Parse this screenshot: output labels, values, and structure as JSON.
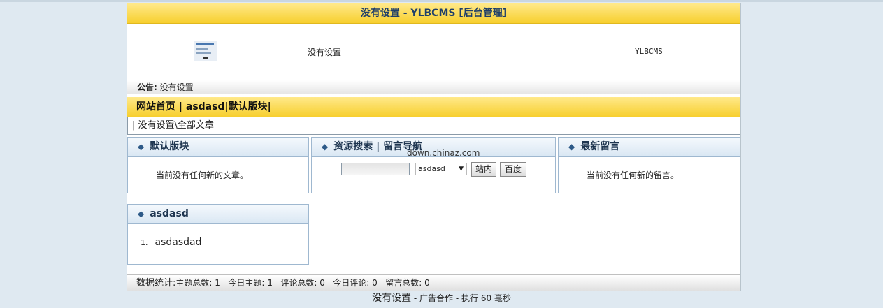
{
  "header": {
    "title_prefix": "没有设置",
    "title_cms": "- YLBCMS [后台管理]"
  },
  "site": {
    "name": "没有设置",
    "right_text": "YLBCMS"
  },
  "notice": {
    "label": "公告:",
    "text": "没有设置"
  },
  "nav": {
    "items": [
      "网站首页",
      "asdasd",
      "默认版块"
    ],
    "sep": "|"
  },
  "breadcrumb": "| 没有设置\\全部文章",
  "boxes": {
    "default_section": {
      "title": "默认版块",
      "empty": "当前没有任何新的文章。"
    },
    "resource_search": {
      "title": "资源搜索 | 留言导航",
      "select_value": "asdasd",
      "btn_site": "站内",
      "btn_baidu": "百度"
    },
    "latest_messages": {
      "title": "最新留言",
      "empty": "当前没有任何新的留言。"
    },
    "asdasd": {
      "title": "asdasd",
      "items": [
        {
          "num": "1.",
          "text": "asdasdad"
        }
      ]
    }
  },
  "watermark": "down.chinaz.com",
  "stats": {
    "label": "数据统计:",
    "topics_label": "主题总数:",
    "topics": "1",
    "today_topics_label": "今日主题:",
    "today_topics": "1",
    "comments_label": "评论总数:",
    "comments": "0",
    "today_comments_label": "今日评论:",
    "today_comments": "0",
    "messages_label": "留言总数:",
    "messages": "0"
  },
  "footer": {
    "name": "没有设置",
    "rest": "- 广告合作 - 执行 60 毫秒"
  },
  "colors": {
    "header_yellow": "#f7cf2e",
    "title_blue": "#1f3f6a",
    "box_border": "#9fb8d0",
    "page_bg": "#dfe9f1"
  }
}
